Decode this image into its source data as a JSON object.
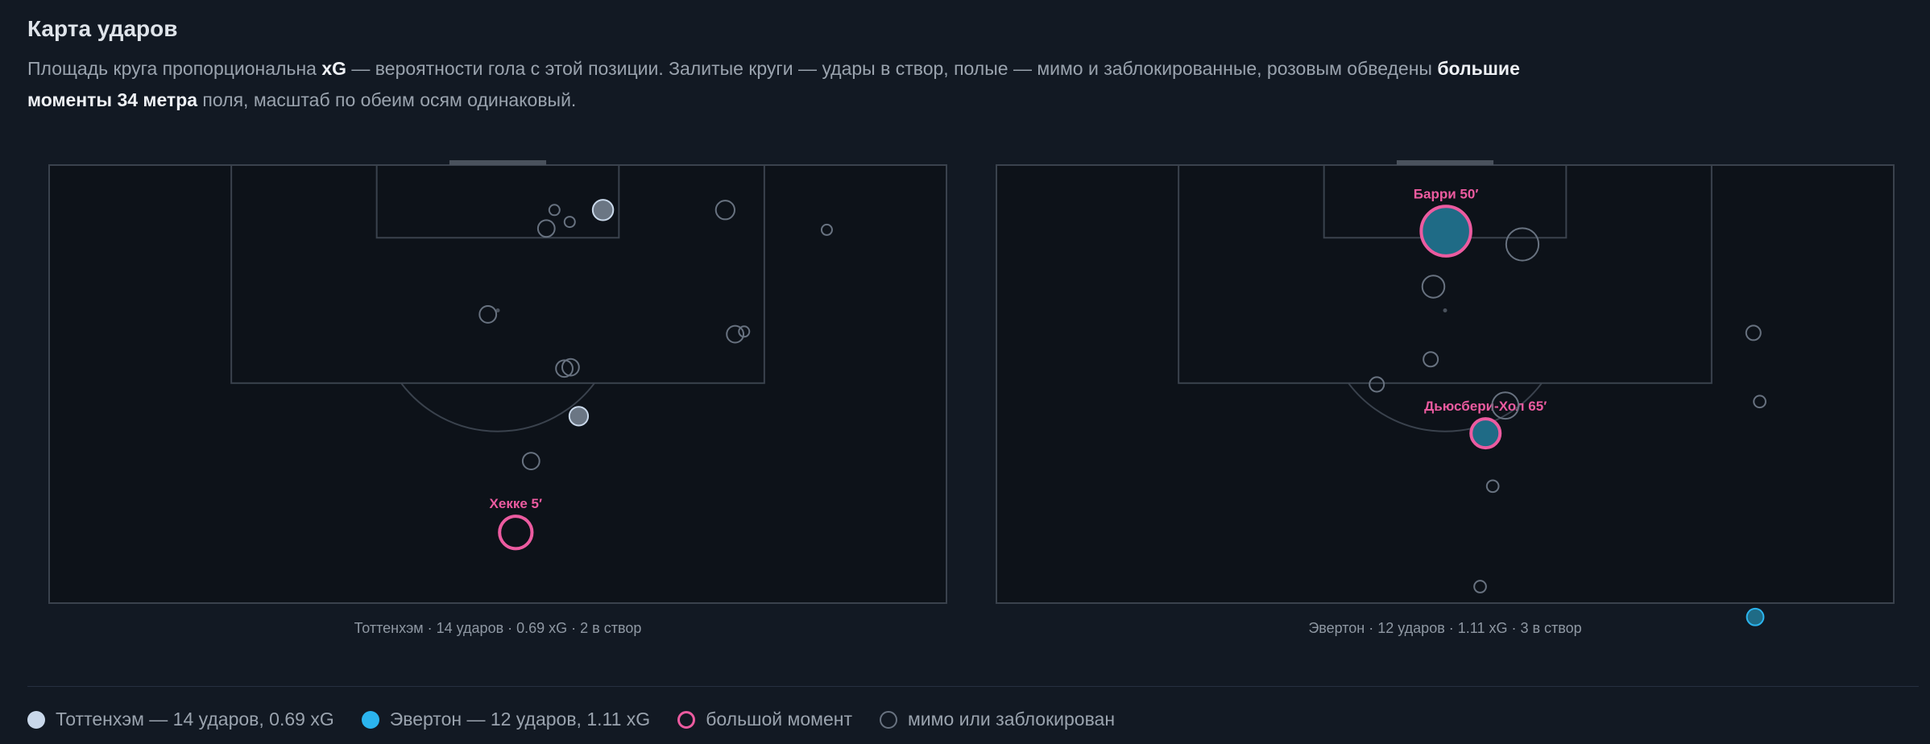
{
  "header": {
    "title": "Карта ударов",
    "desc_1": "Площадь круга пропорциональна ",
    "desc_2": "xG",
    "desc_3": " — вероятности гола с этой позиции. Залитые круги — удары в створ, полые — мимо и заблокированные, розовым обведены ",
    "desc_4": "большие моменты 34 метра",
    "desc_5": " поля, масштаб по обеим осям одинаковый."
  },
  "colors": {
    "tottenham": "#c9d8ea",
    "everton": "#2bb4ee",
    "big_chance": "#ec5ba0",
    "miss": "#687280",
    "pitch_line": "#3a424d",
    "pitch_bg": "#0d1219"
  },
  "chart_data": [
    {
      "type": "scatter",
      "team": "Тоттенхэм",
      "caption": "Тоттенхэм · 14 ударов · 0.69 xG · 2 в створ",
      "shots": [
        {
          "x": 52.0,
          "y": 27.8,
          "xg": 0.15,
          "on_target": false,
          "big_chance": true,
          "label": "Хекке 5′"
        },
        {
          "x": 53.7,
          "y": 22.4,
          "xg": 0.04,
          "on_target": false,
          "big_chance": false
        },
        {
          "x": 57.4,
          "y": 15.4,
          "xg": 0.04,
          "on_target": false,
          "big_chance": false
        },
        {
          "x": 55.4,
          "y": 4.8,
          "xg": 0.04,
          "on_target": false,
          "big_chance": false
        },
        {
          "x": 48.9,
          "y": 11.3,
          "xg": 0.04,
          "on_target": false,
          "big_chance": false
        },
        {
          "x": 59.0,
          "y": 19.0,
          "xg": 0.05,
          "on_target": true,
          "big_chance": false
        },
        {
          "x": 58.1,
          "y": 15.3,
          "xg": 0.04,
          "on_target": false,
          "big_chance": false
        },
        {
          "x": 56.3,
          "y": 3.4,
          "xg": 0.01,
          "on_target": false,
          "big_chance": false
        },
        {
          "x": 58.0,
          "y": 4.3,
          "xg": 0.01,
          "on_target": false,
          "big_chance": false
        },
        {
          "x": 61.7,
          "y": 3.4,
          "xg": 0.06,
          "on_target": true,
          "big_chance": false
        },
        {
          "x": 75.3,
          "y": 3.4,
          "xg": 0.05,
          "on_target": false,
          "big_chance": false
        },
        {
          "x": 76.4,
          "y": 12.8,
          "xg": 0.04,
          "on_target": false,
          "big_chance": false
        },
        {
          "x": 77.4,
          "y": 12.6,
          "xg": 0.01,
          "on_target": false,
          "big_chance": false
        },
        {
          "x": 86.6,
          "y": 4.9,
          "xg": 0.01,
          "on_target": false,
          "big_chance": false
        }
      ]
    },
    {
      "type": "scatter",
      "team": "Эвертон",
      "caption": "Эвертон · 12 ударов · 1.11 xG · 3 в створ",
      "shots": [
        {
          "x": 50.1,
          "y": 5.0,
          "xg": 0.35,
          "on_target": true,
          "big_chance": true,
          "label": "Барри 50′"
        },
        {
          "x": 58.6,
          "y": 6.0,
          "xg": 0.15,
          "on_target": false,
          "big_chance": false
        },
        {
          "x": 48.7,
          "y": 9.2,
          "xg": 0.07,
          "on_target": false,
          "big_chance": false
        },
        {
          "x": 48.4,
          "y": 14.7,
          "xg": 0.03,
          "on_target": false,
          "big_chance": false
        },
        {
          "x": 42.4,
          "y": 16.6,
          "xg": 0.03,
          "on_target": false,
          "big_chance": false
        },
        {
          "x": 56.7,
          "y": 18.2,
          "xg": 0.1,
          "on_target": false,
          "big_chance": false
        },
        {
          "x": 54.5,
          "y": 20.3,
          "xg": 0.12,
          "on_target": true,
          "big_chance": true,
          "label": "Дьюсбери-Хол 65′"
        },
        {
          "x": 55.3,
          "y": 24.3,
          "xg": 0.02,
          "on_target": false,
          "big_chance": false
        },
        {
          "x": 53.9,
          "y": 31.9,
          "xg": 0.02,
          "on_target": false,
          "big_chance": false
        },
        {
          "x": 84.5,
          "y": 34.2,
          "xg": 0.04,
          "on_target": true,
          "big_chance": false
        },
        {
          "x": 84.3,
          "y": 12.7,
          "xg": 0.03,
          "on_target": false,
          "big_chance": false
        },
        {
          "x": 85.0,
          "y": 17.9,
          "xg": 0.02,
          "on_target": false,
          "big_chance": false
        }
      ]
    }
  ],
  "legend": {
    "tottenham": "Тоттенхэм — 14 ударов, 0.69 xG",
    "everton": "Эвертон — 12 ударов, 1.11 xG",
    "big": "большой момент",
    "miss": "мимо или заблокирован"
  }
}
